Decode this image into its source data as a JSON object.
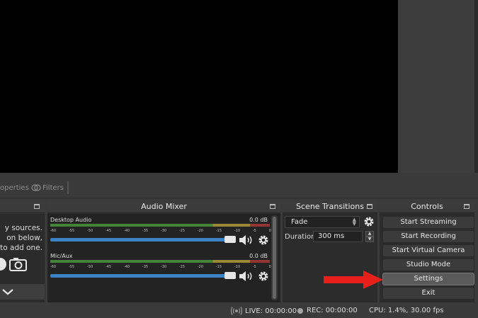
{
  "toolbar": {
    "properties_label": "operties",
    "filters_label": "Filters"
  },
  "sources": {
    "title": "",
    "text_lines": [
      "y sources.",
      "on below,",
      "to add one."
    ]
  },
  "audio_mixer": {
    "title": "Audio Mixer",
    "tick_labels": [
      "-60",
      "-55",
      "-50",
      "-45",
      "-40",
      "-35",
      "-30",
      "-25",
      "-20",
      "-15",
      "-10",
      "-5",
      "0"
    ],
    "channels": [
      {
        "name": "Desktop Audio",
        "db": "0.0 dB"
      },
      {
        "name": "Mic/Aux",
        "db": "0.0 dB"
      }
    ]
  },
  "scene_transitions": {
    "title": "Scene Transitions",
    "transition": "Fade",
    "duration_label": "Duration",
    "duration_value": "300 ms"
  },
  "controls": {
    "title": "Controls",
    "buttons": [
      "Start Streaming",
      "Start Recording",
      "Start Virtual Camera",
      "Studio Mode",
      "Settings",
      "Exit"
    ],
    "highlighted": "Settings"
  },
  "annotation": {
    "arrow_color": "#e8201c"
  },
  "status_bar": {
    "live": "LIVE: 00:00:00",
    "rec": "REC: 00:00:00",
    "cpu": "CPU: 1.4%, 30.00 fps"
  },
  "colors": {
    "accent": "#3d82c4",
    "background": "#2a2a2a"
  }
}
